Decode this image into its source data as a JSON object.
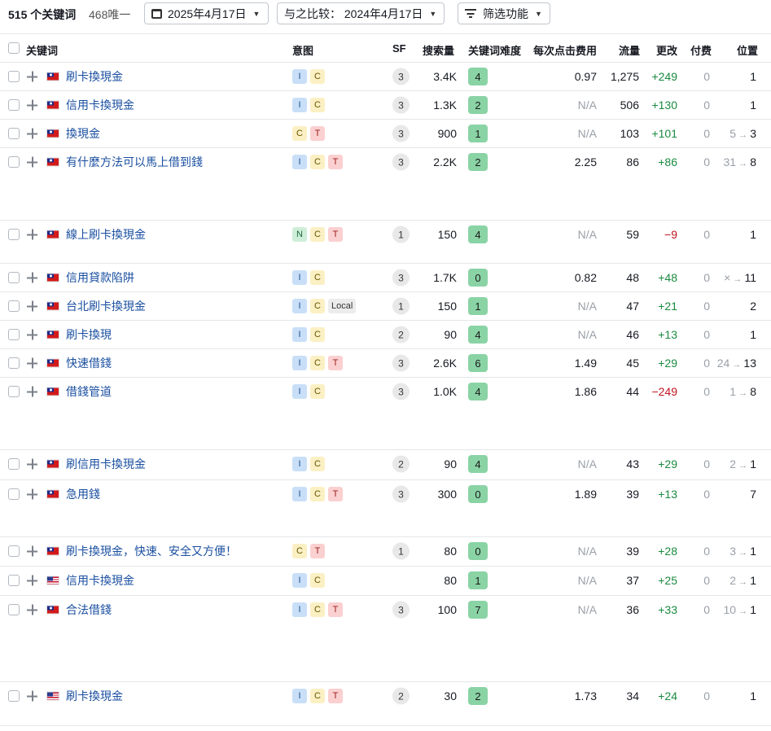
{
  "topbar": {
    "count_title": "515 个关键词",
    "unique": "468唯一",
    "date_label": "2025年4月17日",
    "compare_label": "与之比较：  2024年4月17日",
    "filter_label": "筛选功能"
  },
  "columns": {
    "keyword": "关键词",
    "intent": "意图",
    "sf": "SF",
    "volume": "搜索量",
    "kd": "关键词难度",
    "cpc": "每次点击费用",
    "traffic": "流量",
    "change": "更改",
    "paid": "付费",
    "position": "位置"
  },
  "rows": [
    {
      "keyword": "刷卡換現金",
      "flag": "tw",
      "intents": [
        "I",
        "C"
      ],
      "sf": "3",
      "volume": "3.4K",
      "kd": "4",
      "cpc": "0.97",
      "traffic": "1,275",
      "change": "+249",
      "change_dir": "up",
      "paid": "0",
      "pos": "1"
    },
    {
      "keyword": "信用卡換現金",
      "flag": "tw",
      "intents": [
        "I",
        "C"
      ],
      "sf": "3",
      "volume": "1.3K",
      "kd": "2",
      "cpc": "N/A",
      "traffic": "506",
      "change": "+130",
      "change_dir": "up",
      "paid": "0",
      "pos": "1"
    },
    {
      "keyword": "換現金",
      "flag": "tw",
      "intents": [
        "C",
        "T"
      ],
      "sf": "3",
      "volume": "900",
      "kd": "1",
      "cpc": "N/A",
      "traffic": "103",
      "change": "+101",
      "change_dir": "up",
      "paid": "0",
      "pos_from": "5",
      "pos": "3"
    },
    {
      "keyword": "有什麼方法可以馬上借到錢",
      "flag": "tw",
      "intents": [
        "I",
        "C",
        "T"
      ],
      "sf": "3",
      "volume": "2.2K",
      "kd": "2",
      "cpc": "2.25",
      "traffic": "86",
      "change": "+86",
      "change_dir": "up",
      "paid": "0",
      "pos_from": "31",
      "pos": "8"
    },
    {
      "keyword": "線上刷卡換現金",
      "flag": "tw",
      "intents": [
        "N",
        "C",
        "T"
      ],
      "sf": "1",
      "volume": "150",
      "kd": "4",
      "cpc": "N/A",
      "traffic": "59",
      "change": "−9",
      "change_dir": "down",
      "paid": "0",
      "pos": "1"
    },
    {
      "keyword": "信用貸款陷阱",
      "flag": "tw",
      "intents": [
        "I",
        "C"
      ],
      "sf": "3",
      "volume": "1.7K",
      "kd": "0",
      "cpc": "0.82",
      "traffic": "48",
      "change": "+48",
      "change_dir": "up",
      "paid": "0",
      "pos_from": "×",
      "pos": "11"
    },
    {
      "keyword": "台北刷卡換現金",
      "flag": "tw",
      "intents": [
        "I",
        "C",
        "Local"
      ],
      "sf": "1",
      "volume": "150",
      "kd": "1",
      "cpc": "N/A",
      "traffic": "47",
      "change": "+21",
      "change_dir": "up",
      "paid": "0",
      "pos": "2"
    },
    {
      "keyword": "刷卡換現",
      "flag": "tw",
      "intents": [
        "I",
        "C"
      ],
      "sf": "2",
      "volume": "90",
      "kd": "4",
      "cpc": "N/A",
      "traffic": "46",
      "change": "+13",
      "change_dir": "up",
      "paid": "0",
      "pos": "1"
    },
    {
      "keyword": "快速借錢",
      "flag": "tw",
      "intents": [
        "I",
        "C",
        "T"
      ],
      "sf": "3",
      "volume": "2.6K",
      "kd": "6",
      "cpc": "1.49",
      "traffic": "45",
      "change": "+29",
      "change_dir": "up",
      "paid": "0",
      "pos_from": "24",
      "pos": "13"
    },
    {
      "keyword": "借錢管道",
      "flag": "tw",
      "intents": [
        "I",
        "C"
      ],
      "sf": "3",
      "volume": "1.0K",
      "kd": "4",
      "cpc": "1.86",
      "traffic": "44",
      "change": "−249",
      "change_dir": "down",
      "paid": "0",
      "pos_from": "1",
      "pos": "8"
    },
    {
      "keyword": "刷信用卡換現金",
      "flag": "tw",
      "intents": [
        "I",
        "C"
      ],
      "sf": "2",
      "volume": "90",
      "kd": "4",
      "cpc": "N/A",
      "traffic": "43",
      "change": "+29",
      "change_dir": "up",
      "paid": "0",
      "pos_from": "2",
      "pos": "1"
    },
    {
      "keyword": "急用錢",
      "flag": "tw",
      "intents": [
        "I",
        "C",
        "T"
      ],
      "sf": "3",
      "volume": "300",
      "kd": "0",
      "cpc": "1.89",
      "traffic": "39",
      "change": "+13",
      "change_dir": "up",
      "paid": "0",
      "pos": "7"
    },
    {
      "keyword": "刷卡換現金，快速、安全又方便！",
      "flag": "tw",
      "intents": [
        "C",
        "T"
      ],
      "sf": "1",
      "volume": "80",
      "kd": "0",
      "cpc": "N/A",
      "traffic": "39",
      "change": "+28",
      "change_dir": "up",
      "paid": "0",
      "pos_from": "3",
      "pos": "1"
    },
    {
      "keyword": "信用卡換現金",
      "flag": "us",
      "intents": [
        "I",
        "C"
      ],
      "sf": "",
      "volume": "80",
      "kd": "1",
      "cpc": "N/A",
      "traffic": "37",
      "change": "+25",
      "change_dir": "up",
      "paid": "0",
      "pos_from": "2",
      "pos": "1"
    },
    {
      "keyword": "合法借錢",
      "flag": "tw",
      "intents": [
        "I",
        "C",
        "T"
      ],
      "sf": "3",
      "volume": "100",
      "kd": "7",
      "cpc": "N/A",
      "traffic": "36",
      "change": "+33",
      "change_dir": "up",
      "paid": "0",
      "pos_from": "10",
      "pos": "1"
    },
    {
      "keyword": "刷卡換現金",
      "flag": "us",
      "intents": [
        "I",
        "C",
        "T"
      ],
      "sf": "2",
      "volume": "30",
      "kd": "2",
      "cpc": "1.73",
      "traffic": "34",
      "change": "+24",
      "change_dir": "up",
      "paid": "0",
      "pos": "1"
    }
  ]
}
